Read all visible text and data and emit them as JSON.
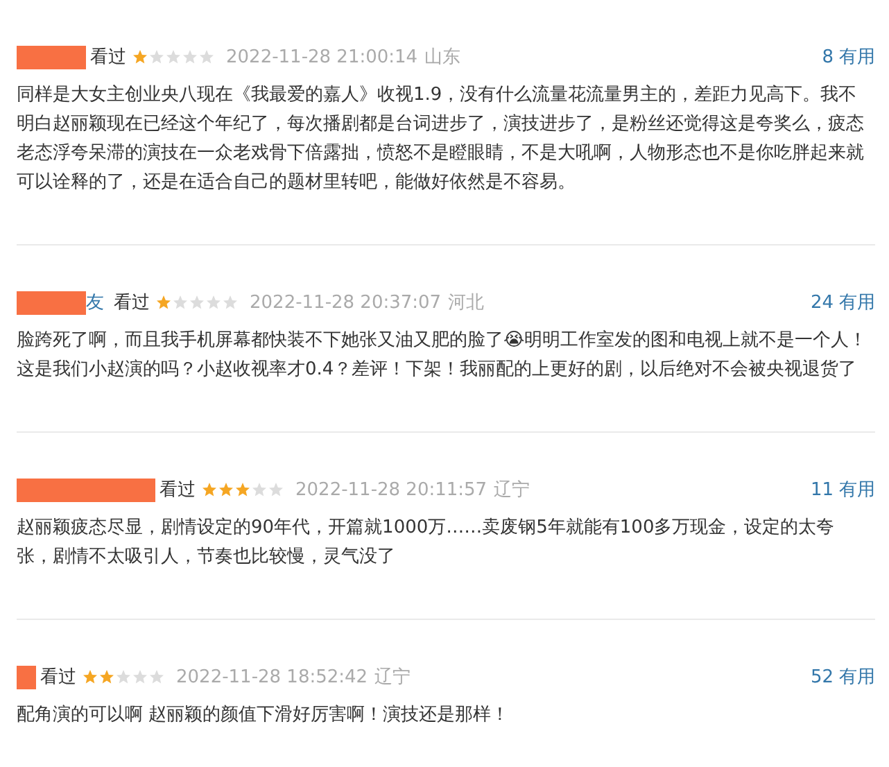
{
  "comments": [
    {
      "status": "看过",
      "stars": 1,
      "time": "2022-11-28 21:00:14",
      "location": "山东",
      "votes": "8",
      "vote_label": "有用",
      "text": "同样是大女主创业央八现在《我最爱的嘉人》收视1.9，没有什么流量花流量男主的，差距力见高下。我不明白赵丽颖现在已经这个年纪了，每次播剧都是台词进步了，演技进步了，是粉丝还觉得这是夸奖么，疲态老态浮夸呆滞的演技在一众老戏骨下倍露拙，愤怒不是瞪眼睛，不是大吼啊，人物形态也不是你吃胖起来就可以诠释的了，还是在适合自己的题材里转吧，能做好依然是不容易。"
    },
    {
      "username": "友",
      "status": "看过",
      "stars": 1,
      "time": "2022-11-28 20:37:07",
      "location": "河北",
      "votes": "24",
      "vote_label": "有用",
      "text": "脸跨死了啊，而且我手机屏幕都快装不下她张又油又肥的脸了😭明明工作室发的图和电视上就不是一个人！这是我们小赵演的吗？小赵收视率才0.4？差评！下架！我丽配的上更好的剧，以后绝对不会被央视退货了"
    },
    {
      "status": "看过",
      "stars": 3,
      "time": "2022-11-28 20:11:57",
      "location": "辽宁",
      "votes": "11",
      "vote_label": "有用",
      "text": "赵丽颖疲态尽显，剧情设定的90年代，开篇就1000万……卖废钢5年就能有100多万现金，设定的太夸张，剧情不太吸引人，节奏也比较慢，灵气没了"
    },
    {
      "status": "看过",
      "stars": 2,
      "time": "2022-11-28 18:52:42",
      "location": "辽宁",
      "votes": "52",
      "vote_label": "有用",
      "text": "配角演的可以啊 赵丽颖的颜值下滑好厉害啊！演技还是那样！"
    }
  ]
}
